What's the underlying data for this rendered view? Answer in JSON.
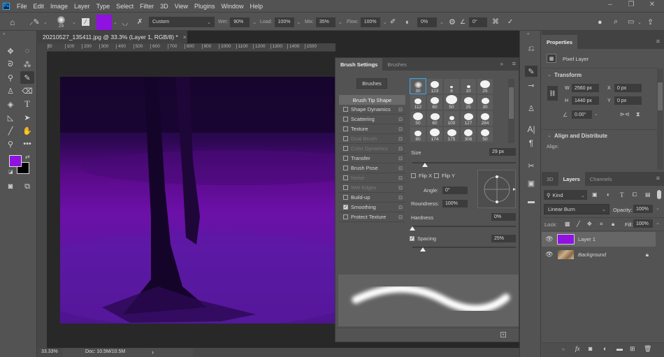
{
  "app": {
    "logo": "Ps",
    "menu": [
      "File",
      "Edit",
      "Image",
      "Layer",
      "Type",
      "Select",
      "Filter",
      "3D",
      "View",
      "Plugins",
      "Window",
      "Help"
    ]
  },
  "window_controls": {
    "minimize": "–",
    "restore": "❐",
    "close": "✕"
  },
  "options_bar": {
    "brush_size": "29",
    "preset": "Custom",
    "foreground_color": "#9012e0",
    "wet_label": "Wet:",
    "wet_value": "90%",
    "load_label": "Load:",
    "load_value": "100%",
    "mix_label": "Mix:",
    "mix_value": "35%",
    "flow_label": "Flow:",
    "flow_value": "100%",
    "smoothing_value": "0%",
    "angle_value": "0°"
  },
  "document": {
    "tab_title": "20210527_135411.jpg @ 33.3% (Layer 1, RGB/8) *",
    "close": "×",
    "ruler_ticks": [
      "00",
      "0",
      "100",
      "200",
      "300",
      "400",
      "500",
      "600",
      "700",
      "800",
      "900",
      "1000",
      "1100",
      "1200",
      "1300",
      "1400",
      "1500"
    ],
    "zoom": "33.33%",
    "doc_info": "Doc: 10.5M/10.5M",
    "status_arrow": "›"
  },
  "tools": {
    "foreground": "#9012e0",
    "background": "#000000"
  },
  "brush_settings": {
    "tabs": [
      "Brush Settings",
      "Brushes"
    ],
    "brushes_button": "Brushes",
    "tip_shape": "Brush Tip Shape",
    "options": [
      {
        "label": "Shape Dynamics",
        "checked": false,
        "disabled": false
      },
      {
        "label": "Scattering",
        "checked": false,
        "disabled": false
      },
      {
        "label": "Texture",
        "checked": false,
        "disabled": false
      },
      {
        "label": "Dual Brush",
        "checked": false,
        "disabled": true
      },
      {
        "label": "Color Dynamics",
        "checked": false,
        "disabled": true
      },
      {
        "label": "Transfer",
        "checked": false,
        "disabled": false
      },
      {
        "label": "Brush Pose",
        "checked": false,
        "disabled": false
      },
      {
        "label": "Noise",
        "checked": false,
        "disabled": true
      },
      {
        "label": "Wet Edges",
        "checked": false,
        "disabled": true
      },
      {
        "label": "Build-up",
        "checked": false,
        "disabled": false
      },
      {
        "label": "Smoothing",
        "checked": true,
        "disabled": false
      },
      {
        "label": "Protect Texture",
        "checked": false,
        "disabled": false
      }
    ],
    "tips": [
      "30",
      "123",
      "8",
      "10",
      "25",
      "112",
      "60",
      "50",
      "25",
      "30",
      "50",
      "60",
      "100",
      "127",
      "284",
      "80",
      "174",
      "175",
      "306",
      "50"
    ],
    "size_label": "Size",
    "size_value": "29 px",
    "size_fraction": 0.12,
    "flip_x": "Flip X",
    "flip_y": "Flip Y",
    "angle_label": "Angle:",
    "angle_value": "0°",
    "roundness_label": "Roundness:",
    "roundness_value": "100%",
    "hardness_label": "Hardness",
    "hardness_value": "0%",
    "hardness_fraction": 0.0,
    "spacing_label": "Spacing",
    "spacing_value": "25%",
    "spacing_fraction": 0.1
  },
  "properties": {
    "title": "Properties",
    "layer_type": "Pixel Layer",
    "transform": "Transform",
    "w_label": "W",
    "w": "2560 px",
    "h_label": "H",
    "h": "1440 px",
    "x_label": "X",
    "x": "0 px",
    "y_label": "Y",
    "y": "0 px",
    "angle": "0.00°",
    "align_section": "Align and Distribute",
    "align_label": "Align:"
  },
  "layers_panel": {
    "tabs": [
      "3D",
      "Layers",
      "Channels"
    ],
    "filter": "Kind",
    "blend_mode": "Linear Burn",
    "opacity_label": "Opacity:",
    "opacity": "100%",
    "lock_label": "Lock:",
    "fill_label": "Fill:",
    "fill": "100%",
    "layers": [
      {
        "name": "Layer 1",
        "selected": true,
        "thumb": "#9012e0"
      },
      {
        "name": "Background",
        "selected": false,
        "locked": true
      }
    ]
  }
}
